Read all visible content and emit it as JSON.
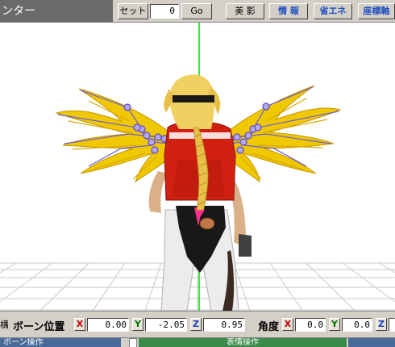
{
  "toolbar": {
    "title": "ンター",
    "set_label": "セット",
    "frame_value": "0",
    "go_label": "Go",
    "bishadow_label": "美 影",
    "info_label": "情 報",
    "energy_label": "省エネ",
    "axis_label": "座標軸"
  },
  "bone": {
    "left_fragment": "構",
    "position_label": "ボーン位置",
    "x_label": "X",
    "x_value": "0.00",
    "y_label": "Y",
    "y_value": "-2.05",
    "z_label": "Z",
    "z_value": "0.95",
    "angle_label": "角度",
    "ax_label": "X",
    "ax_value": "0.0",
    "ay_label": "Y",
    "ay_value": "0.0",
    "az_label": "Z"
  },
  "bottom": {
    "bone_op": "ボーン操作",
    "expr_op": "表情操作"
  },
  "colors": {
    "wing": "#f0c800",
    "bone_marker": "#6f5fd6",
    "jacket": "#d02010",
    "axis_line": "#00e000"
  }
}
